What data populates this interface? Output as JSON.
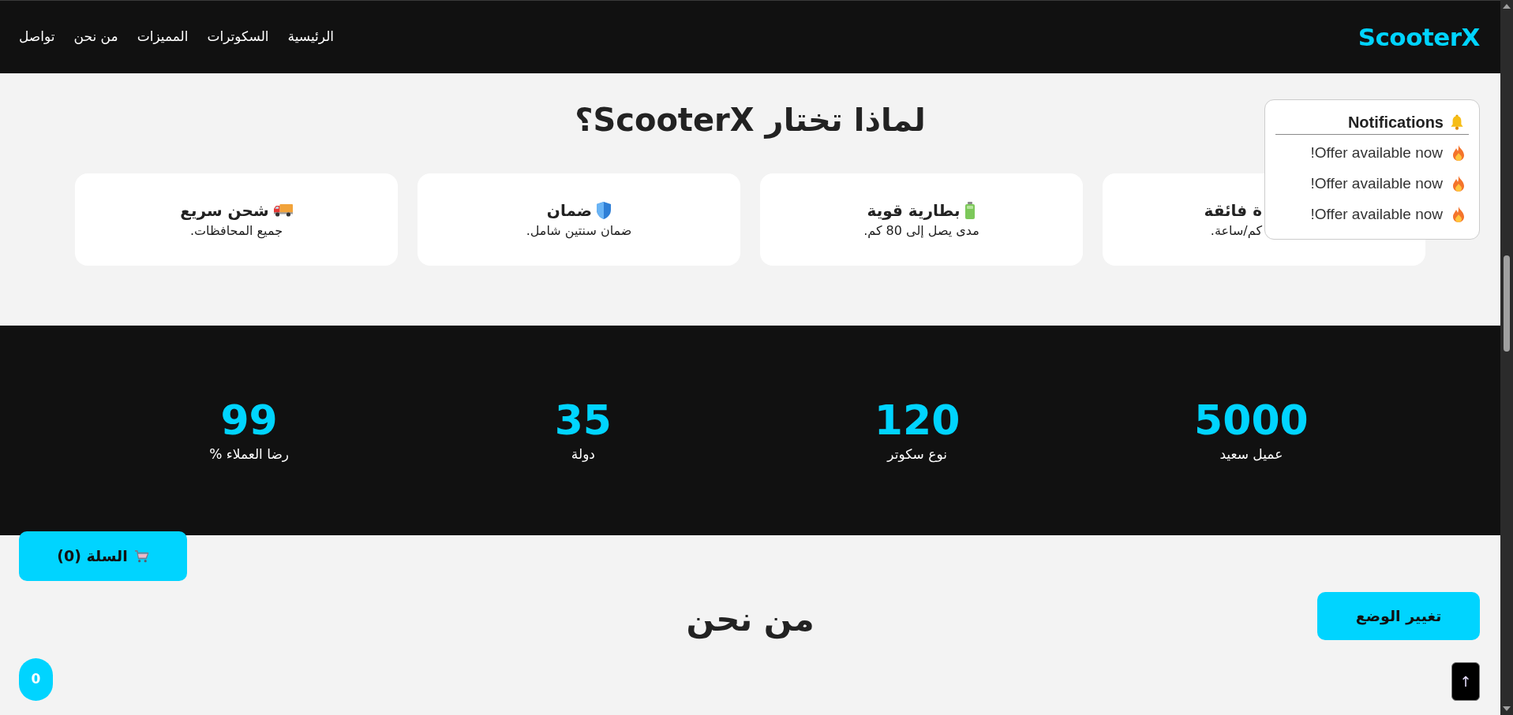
{
  "nav": {
    "logo": "ScooterX",
    "links": [
      "الرئيسية",
      "السكوترات",
      "المميزات",
      "من نحن",
      "تواصل"
    ]
  },
  "features": {
    "title": "لماذا تختار ScooterX؟",
    "cards": [
      {
        "title": "ة فائقة",
        "text": "كم/ساعة."
      },
      {
        "title": "بطارية قوية",
        "text": "مدى يصل إلى 80 كم."
      },
      {
        "title": "ضمان",
        "text": "ضمان سنتين شامل."
      },
      {
        "title": "شحن سريع",
        "text": "جميع المحافظات."
      }
    ]
  },
  "stats": [
    {
      "value": "5000",
      "label": "عميل سعيد"
    },
    {
      "value": "120",
      "label": "نوع سكوتر"
    },
    {
      "value": "35",
      "label": "دولة"
    },
    {
      "value": "99",
      "label": "رضا العملاء %"
    }
  ],
  "about": {
    "title": "من نحن"
  },
  "notifications": {
    "title": "Notifications",
    "items": [
      "!Offer available now",
      "!Offer available now",
      "!Offer available now"
    ]
  },
  "cart_button": "السلة (0)",
  "mode_button": "تغيير الوضع",
  "counter_badge": "0",
  "scroll_top_button": "↑"
}
